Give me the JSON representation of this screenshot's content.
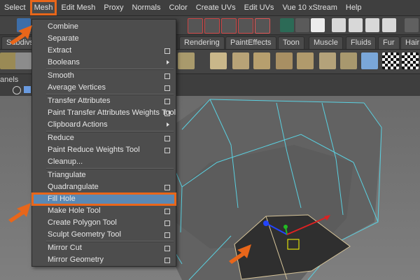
{
  "menubar": {
    "items": [
      "Select",
      "Mesh",
      "Edit Mesh",
      "Proxy",
      "Normals",
      "Color",
      "Create UVs",
      "Edit UVs",
      "Vue 10 xStream",
      "Help"
    ],
    "active_index": 1
  },
  "shelf_tabs": [
    "Subdivs",
    "Rendering",
    "PaintEffects",
    "Toon",
    "Muscle",
    "Fluids",
    "Fur",
    "Hair"
  ],
  "panel": {
    "label": "anels"
  },
  "mesh_menu": {
    "items": [
      {
        "label": "Combine",
        "kind": "none"
      },
      {
        "label": "Separate",
        "kind": "none"
      },
      {
        "label": "Extract",
        "kind": "option"
      },
      {
        "label": "Booleans",
        "kind": "submenu"
      },
      {
        "label": "Smooth",
        "kind": "option"
      },
      {
        "label": "Average Vertices",
        "kind": "option"
      },
      {
        "label": "Transfer Attributes",
        "kind": "option"
      },
      {
        "label": "Paint Transfer Attributes Weights Tool",
        "kind": "option"
      },
      {
        "label": "Clipboard Actions",
        "kind": "submenu"
      },
      {
        "label": "Reduce",
        "kind": "option"
      },
      {
        "label": "Paint Reduce Weights Tool",
        "kind": "option"
      },
      {
        "label": "Cleanup...",
        "kind": "none"
      },
      {
        "label": "Triangulate",
        "kind": "none"
      },
      {
        "label": "Quadrangulate",
        "kind": "option"
      },
      {
        "label": "Fill Hole",
        "kind": "none",
        "highlighted": true
      },
      {
        "label": "Make Hole Tool",
        "kind": "option"
      },
      {
        "label": "Create Polygon Tool",
        "kind": "option"
      },
      {
        "label": "Sculpt Geometry Tool",
        "kind": "option"
      },
      {
        "label": "Mirror Cut",
        "kind": "option"
      },
      {
        "label": "Mirror Geometry",
        "kind": "option"
      }
    ]
  },
  "colors": {
    "callout": "#e8661a",
    "highlight": "#5b88b3",
    "wireframe": "#5ad0e0",
    "polygon": "#3a3a3a"
  }
}
